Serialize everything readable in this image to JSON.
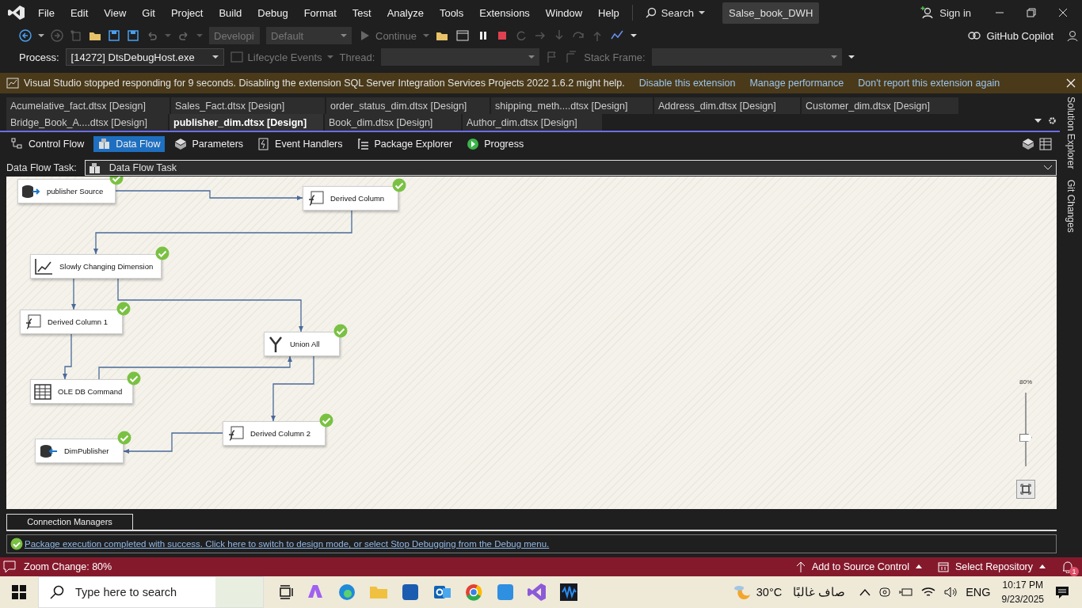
{
  "menu_bar": {
    "items": [
      "File",
      "Edit",
      "View",
      "Git",
      "Project",
      "Build",
      "Debug",
      "Format",
      "Test",
      "Analyze",
      "Tools",
      "Extensions",
      "Window",
      "Help"
    ],
    "search": "Search",
    "solution_name": "Salse_book_DWH",
    "sign_in": "Sign in"
  },
  "toolbar": {
    "configuration": "Developi",
    "platform": "Default",
    "continue": "Continue",
    "copilot": "GitHub Copilot"
  },
  "debug_location": {
    "process_label": "Process:",
    "process": "[14272] DtsDebugHost.exe",
    "lifecycle": "Lifecycle Events",
    "thread_label": "Thread:",
    "stack_frame_label": "Stack Frame:"
  },
  "info_bar": {
    "message": "Visual Studio stopped responding for 9 seconds. Disabling the extension SQL Server Integration Services Projects 2022 1.6.2 might help.",
    "actions": [
      "Disable this extension",
      "Manage performance",
      "Don't report this extension again"
    ]
  },
  "document_tab_rows": [
    [
      {
        "label": "Acumelative_fact.dtsx [Design]",
        "selected": false
      },
      {
        "label": "Sales_Fact.dtsx [Design]",
        "selected": false
      },
      {
        "label": "order_status_dim.dtsx [Design]",
        "selected": false
      },
      {
        "label": "shipping_meth....dtsx [Design]",
        "selected": false
      },
      {
        "label": "Address_dim.dtsx [Design]",
        "selected": false
      },
      {
        "label": "Customer_dim.dtsx [Design]",
        "selected": false
      }
    ],
    [
      {
        "label": "Bridge_Book_A....dtsx [Design]",
        "selected": false
      },
      {
        "label": "publisher_dim.dtsx [Design]",
        "selected": true
      },
      {
        "label": "Book_dim.dtsx [Design]",
        "selected": false
      },
      {
        "label": "Author_dim.dtsx [Design]",
        "selected": false
      }
    ]
  ],
  "designer_tabs": [
    {
      "label": "Control Flow",
      "kind": "control",
      "selected": false
    },
    {
      "label": "Data Flow",
      "kind": "data",
      "selected": true
    },
    {
      "label": "Parameters",
      "kind": "parameters",
      "selected": false
    },
    {
      "label": "Event Handlers",
      "kind": "events",
      "selected": false
    },
    {
      "label": "Package Explorer",
      "kind": "explorer",
      "selected": false
    },
    {
      "label": "Progress",
      "kind": "progress",
      "selected": false
    }
  ],
  "task_selector": {
    "label": "Data Flow Task:",
    "value": "Data Flow Task"
  },
  "canvas": {
    "components": [
      {
        "label": "publisher Source",
        "kind": "source",
        "completed": true
      },
      {
        "label": "Derived Column",
        "kind": "derived",
        "completed": true
      },
      {
        "label": "Slowly Changing Dimension",
        "kind": "scd",
        "completed": true
      },
      {
        "label": "Derived Column 1",
        "kind": "derived",
        "completed": true
      },
      {
        "label": "Union All",
        "kind": "union",
        "completed": true
      },
      {
        "label": "OLE DB Command",
        "kind": "oledb",
        "completed": true
      },
      {
        "label": "Derived Column 2",
        "kind": "derived",
        "completed": true
      },
      {
        "label": "DimPublisher",
        "kind": "destination",
        "completed": true
      }
    ],
    "zoom": {
      "label": "80%",
      "level": 0.39
    }
  },
  "connection_managers": {
    "tab": "Connection Managers"
  },
  "execution_message": "Package execution completed with success. Click here to switch to design mode, or select Stop Debugging from the Debug menu.",
  "side_tabs": [
    "Solution Explorer",
    "Git Changes"
  ],
  "status_bar": {
    "message": "Zoom Change: 80%",
    "source_control": "Add to Source Control",
    "repository": "Select Repository",
    "notifications": "1"
  },
  "taskbar": {
    "search_placeholder": "Type here to search",
    "weather_temp": "30°C",
    "weather_text": "صاف غالبًا",
    "language": "ENG",
    "time": "10:17 PM",
    "date": "9/23/2025"
  }
}
